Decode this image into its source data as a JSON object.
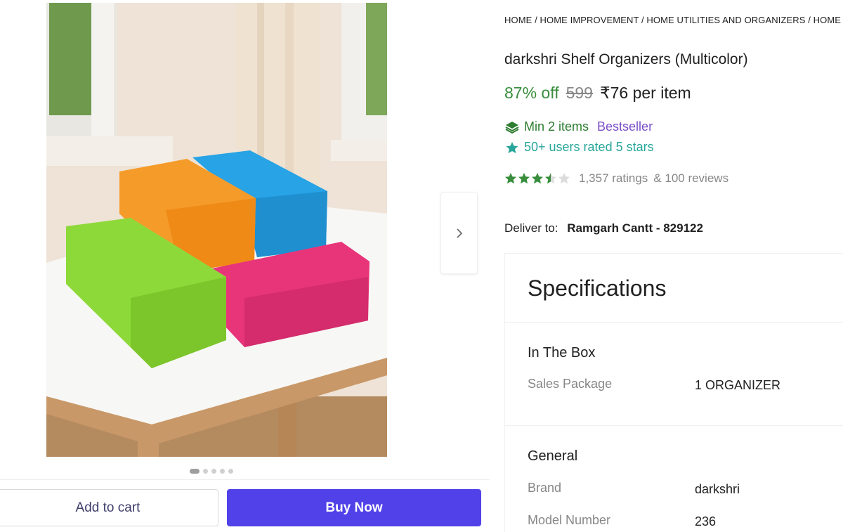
{
  "breadcrumb": "HOME / HOME IMPROVEMENT / HOME UTILITIES AND ORGANIZERS / HOME",
  "product": {
    "title": "darkshri Shelf Organizers (Multicolor)",
    "discount": "87% off",
    "mrp": "599",
    "price": "₹76 per item"
  },
  "offers": {
    "min_items": "Min 2 items",
    "bestseller": "Bestseller",
    "rated": "50+ users rated 5 stars"
  },
  "rating": {
    "stars": 3.5,
    "ratings_text": "1,357 ratings",
    "reviews_text": "& 100 reviews"
  },
  "delivery": {
    "label": "Deliver to:",
    "location": "Ramgarh Cantt - 829122"
  },
  "carousel": {
    "slide_count": 5,
    "active_index": 0
  },
  "actions": {
    "add_to_cart": "Add to cart",
    "buy_now": "Buy Now"
  },
  "specifications": {
    "title": "Specifications",
    "sections": [
      {
        "title": "In The Box",
        "rows": [
          {
            "label": "Sales Package",
            "value": "1 ORGANIZER"
          }
        ]
      },
      {
        "title": "General",
        "rows": [
          {
            "label": "Brand",
            "value": "darkshri"
          },
          {
            "label": "Model Number",
            "value": "236"
          }
        ]
      }
    ]
  },
  "icons": {
    "next": "chevron-right-icon",
    "min_items": "layers-icon",
    "rated": "star-badge-icon",
    "rating": "star-icon"
  },
  "colors": {
    "buy_button": "#5141e8",
    "discount_green": "#388e3c",
    "star_green": "#388e3c",
    "bestseller_purple": "#7b4fc7",
    "rated_teal": "#26a69a"
  }
}
